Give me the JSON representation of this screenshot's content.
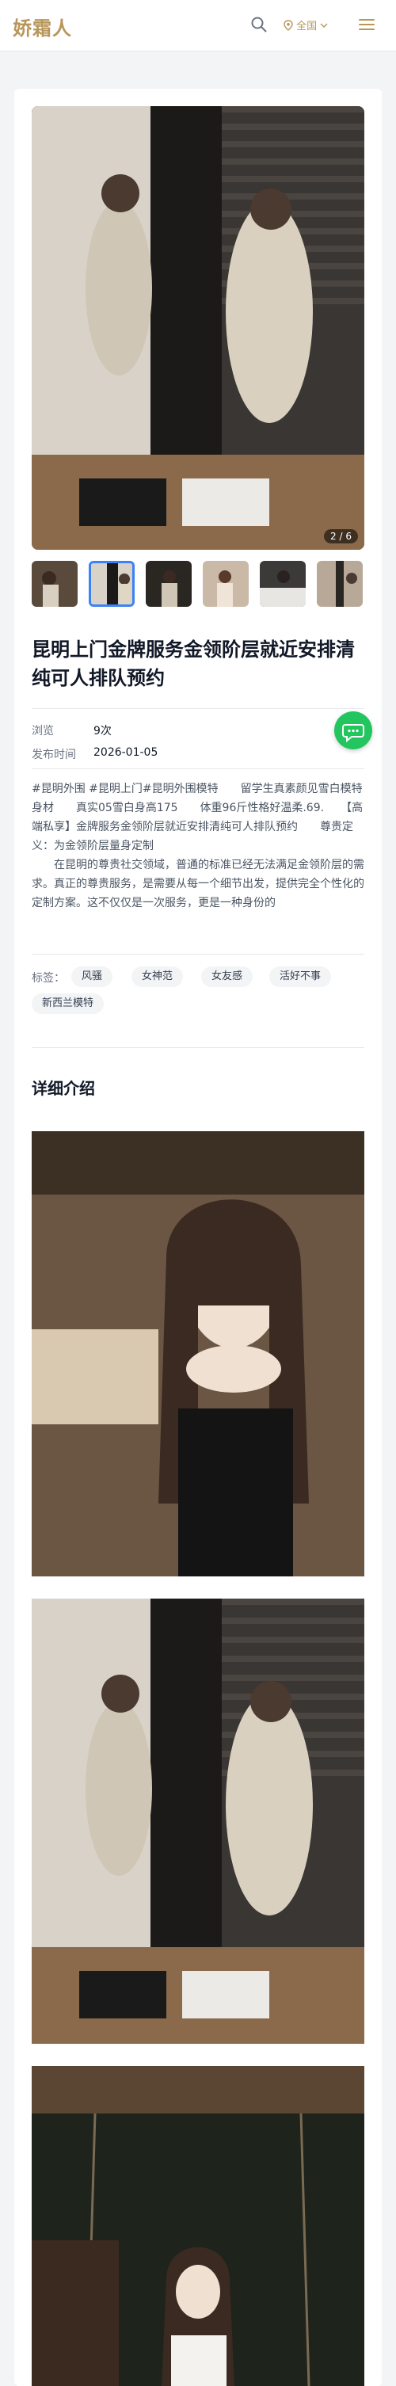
{
  "header": {
    "logo": "娇霜人",
    "region_label": "全国"
  },
  "gallery": {
    "counter": "2 / 6",
    "thumb_count": 6,
    "active_index": 1
  },
  "post": {
    "title": "昆明上门金牌服务金领阶层就近安排清纯可人排队预约",
    "meta": {
      "views_label": "浏览",
      "views_value": "9次",
      "date_label": "发布时间",
      "date_value": "2026-01-05"
    },
    "description": "#昆明外围 #昆明上门#昆明外围模特　　留学生真素颜见雪白模特身材　　真实05雪白身高175　　体重96斤性格好温柔.69.　　【高端私享】金牌服务金领阶层就近安排清纯可人排队预约　　尊贵定义：为金领阶层量身定制\n　　在昆明的尊贵社交领域，普通的标准已经无法满足金领阶层的需求。真正的尊贵服务，是需要从每一个细节出发，提供完全个性化的定制方案。这不仅仅是一次服务，更是一种身份的",
    "tags_label": "标签：",
    "tags": [
      "风骚",
      "女神范",
      "女友感",
      "活好不事",
      "新西兰模特"
    ]
  },
  "details": {
    "section_title": "详细介绍"
  },
  "colors": {
    "brand": "#b8965a",
    "accent": "#3b82f6",
    "fab": "#22c55e"
  },
  "icons": [
    "search-icon",
    "location-pin-icon",
    "chevron-down-icon",
    "menu-icon",
    "chat-icon"
  ]
}
